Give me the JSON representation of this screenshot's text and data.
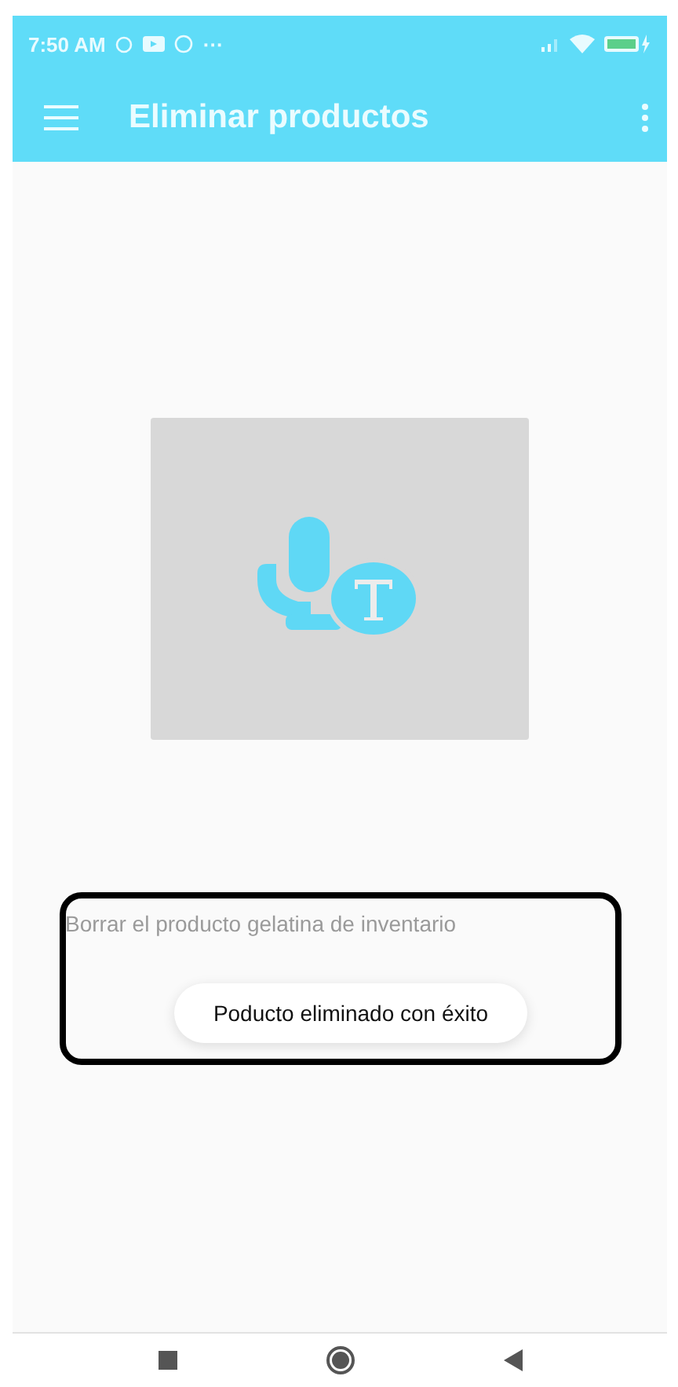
{
  "status_bar": {
    "time": "7:50 AM",
    "more": "···"
  },
  "app_bar": {
    "title": "Eliminar productos"
  },
  "text_field": {
    "placeholder": "Borrar el producto gelatina de inventario"
  },
  "toast": {
    "text": "Poducto eliminado con éxito"
  }
}
